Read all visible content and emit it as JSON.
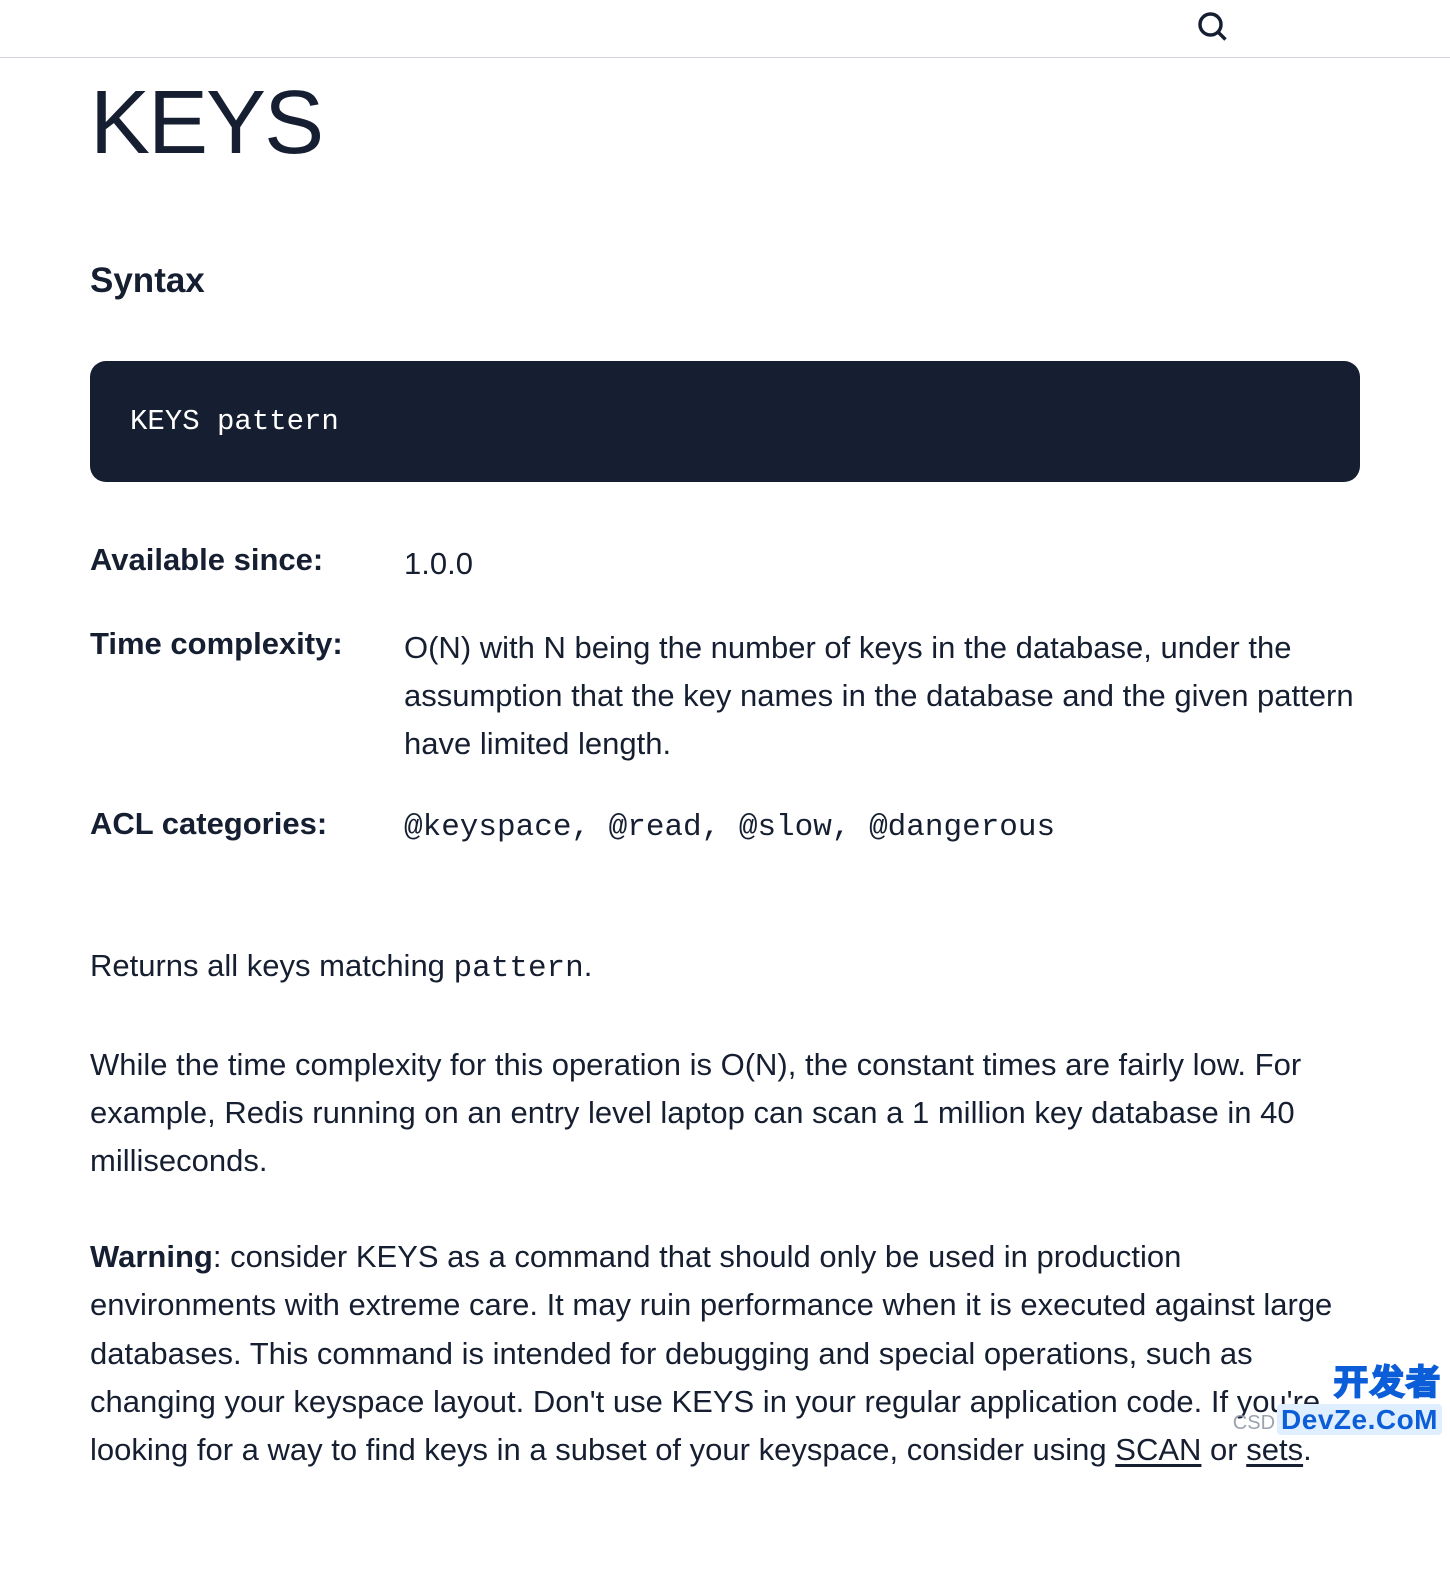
{
  "page": {
    "title": "KEYS",
    "syntax_heading": "Syntax",
    "syntax_code": "KEYS pattern"
  },
  "meta": {
    "available_since_label": "Available since:",
    "available_since_value": "1.0.0",
    "time_complexity_label": "Time complexity:",
    "time_complexity_value": "O(N) with N being the number of keys in the database, under the assumption that the key names in the database and the given pattern have limited length.",
    "acl_label": "ACL categories:",
    "acl_value": "@keyspace, @read, @slow, @dangerous"
  },
  "body": {
    "p1_prefix": "Returns all keys matching ",
    "p1_code": "pattern",
    "p1_suffix": ".",
    "p2": "While the time complexity for this operation is O(N), the constant times are fairly low. For example, Redis running on an entry level laptop can scan a 1 million key database in 40 milliseconds.",
    "p3_warning": "Warning",
    "p3_body": ": consider KEYS as a command that should only be used in production environments with extreme care. It may ruin performance when it is executed against large databases. This command is intended for debugging and special operations, such as changing your keyspace layout. Don't use KEYS in your regular application code. If you're looking for a way to find keys in a subset of your keyspace, consider using ",
    "p3_link1": "SCAN",
    "p3_mid": " or ",
    "p3_link2": "sets",
    "p3_end": "."
  },
  "watermark": {
    "cn": "开发者",
    "sub1": "CSD",
    "sub2": "DevZe.CoM"
  }
}
